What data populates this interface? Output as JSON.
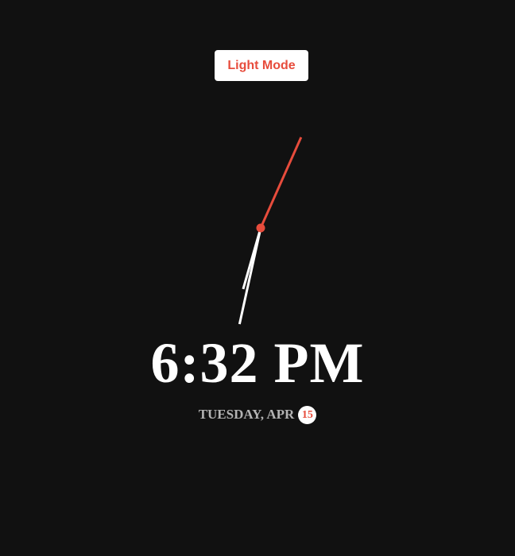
{
  "mode_toggle": {
    "label": "Light Mode"
  },
  "clock": {
    "hours": 6,
    "minutes": 32,
    "seconds": 4,
    "hand_colors": {
      "hour": "#ffffff",
      "minute": "#ffffff",
      "second": "#e74c3c",
      "center_dot": "#e74c3c"
    }
  },
  "digital": {
    "time": "6:32 PM"
  },
  "date": {
    "text": "TUESDAY, APR",
    "day": "15"
  },
  "colors": {
    "background": "#111111",
    "accent": "#e74c3c",
    "text_primary": "#ffffff",
    "text_muted": "#b3b3b3"
  }
}
